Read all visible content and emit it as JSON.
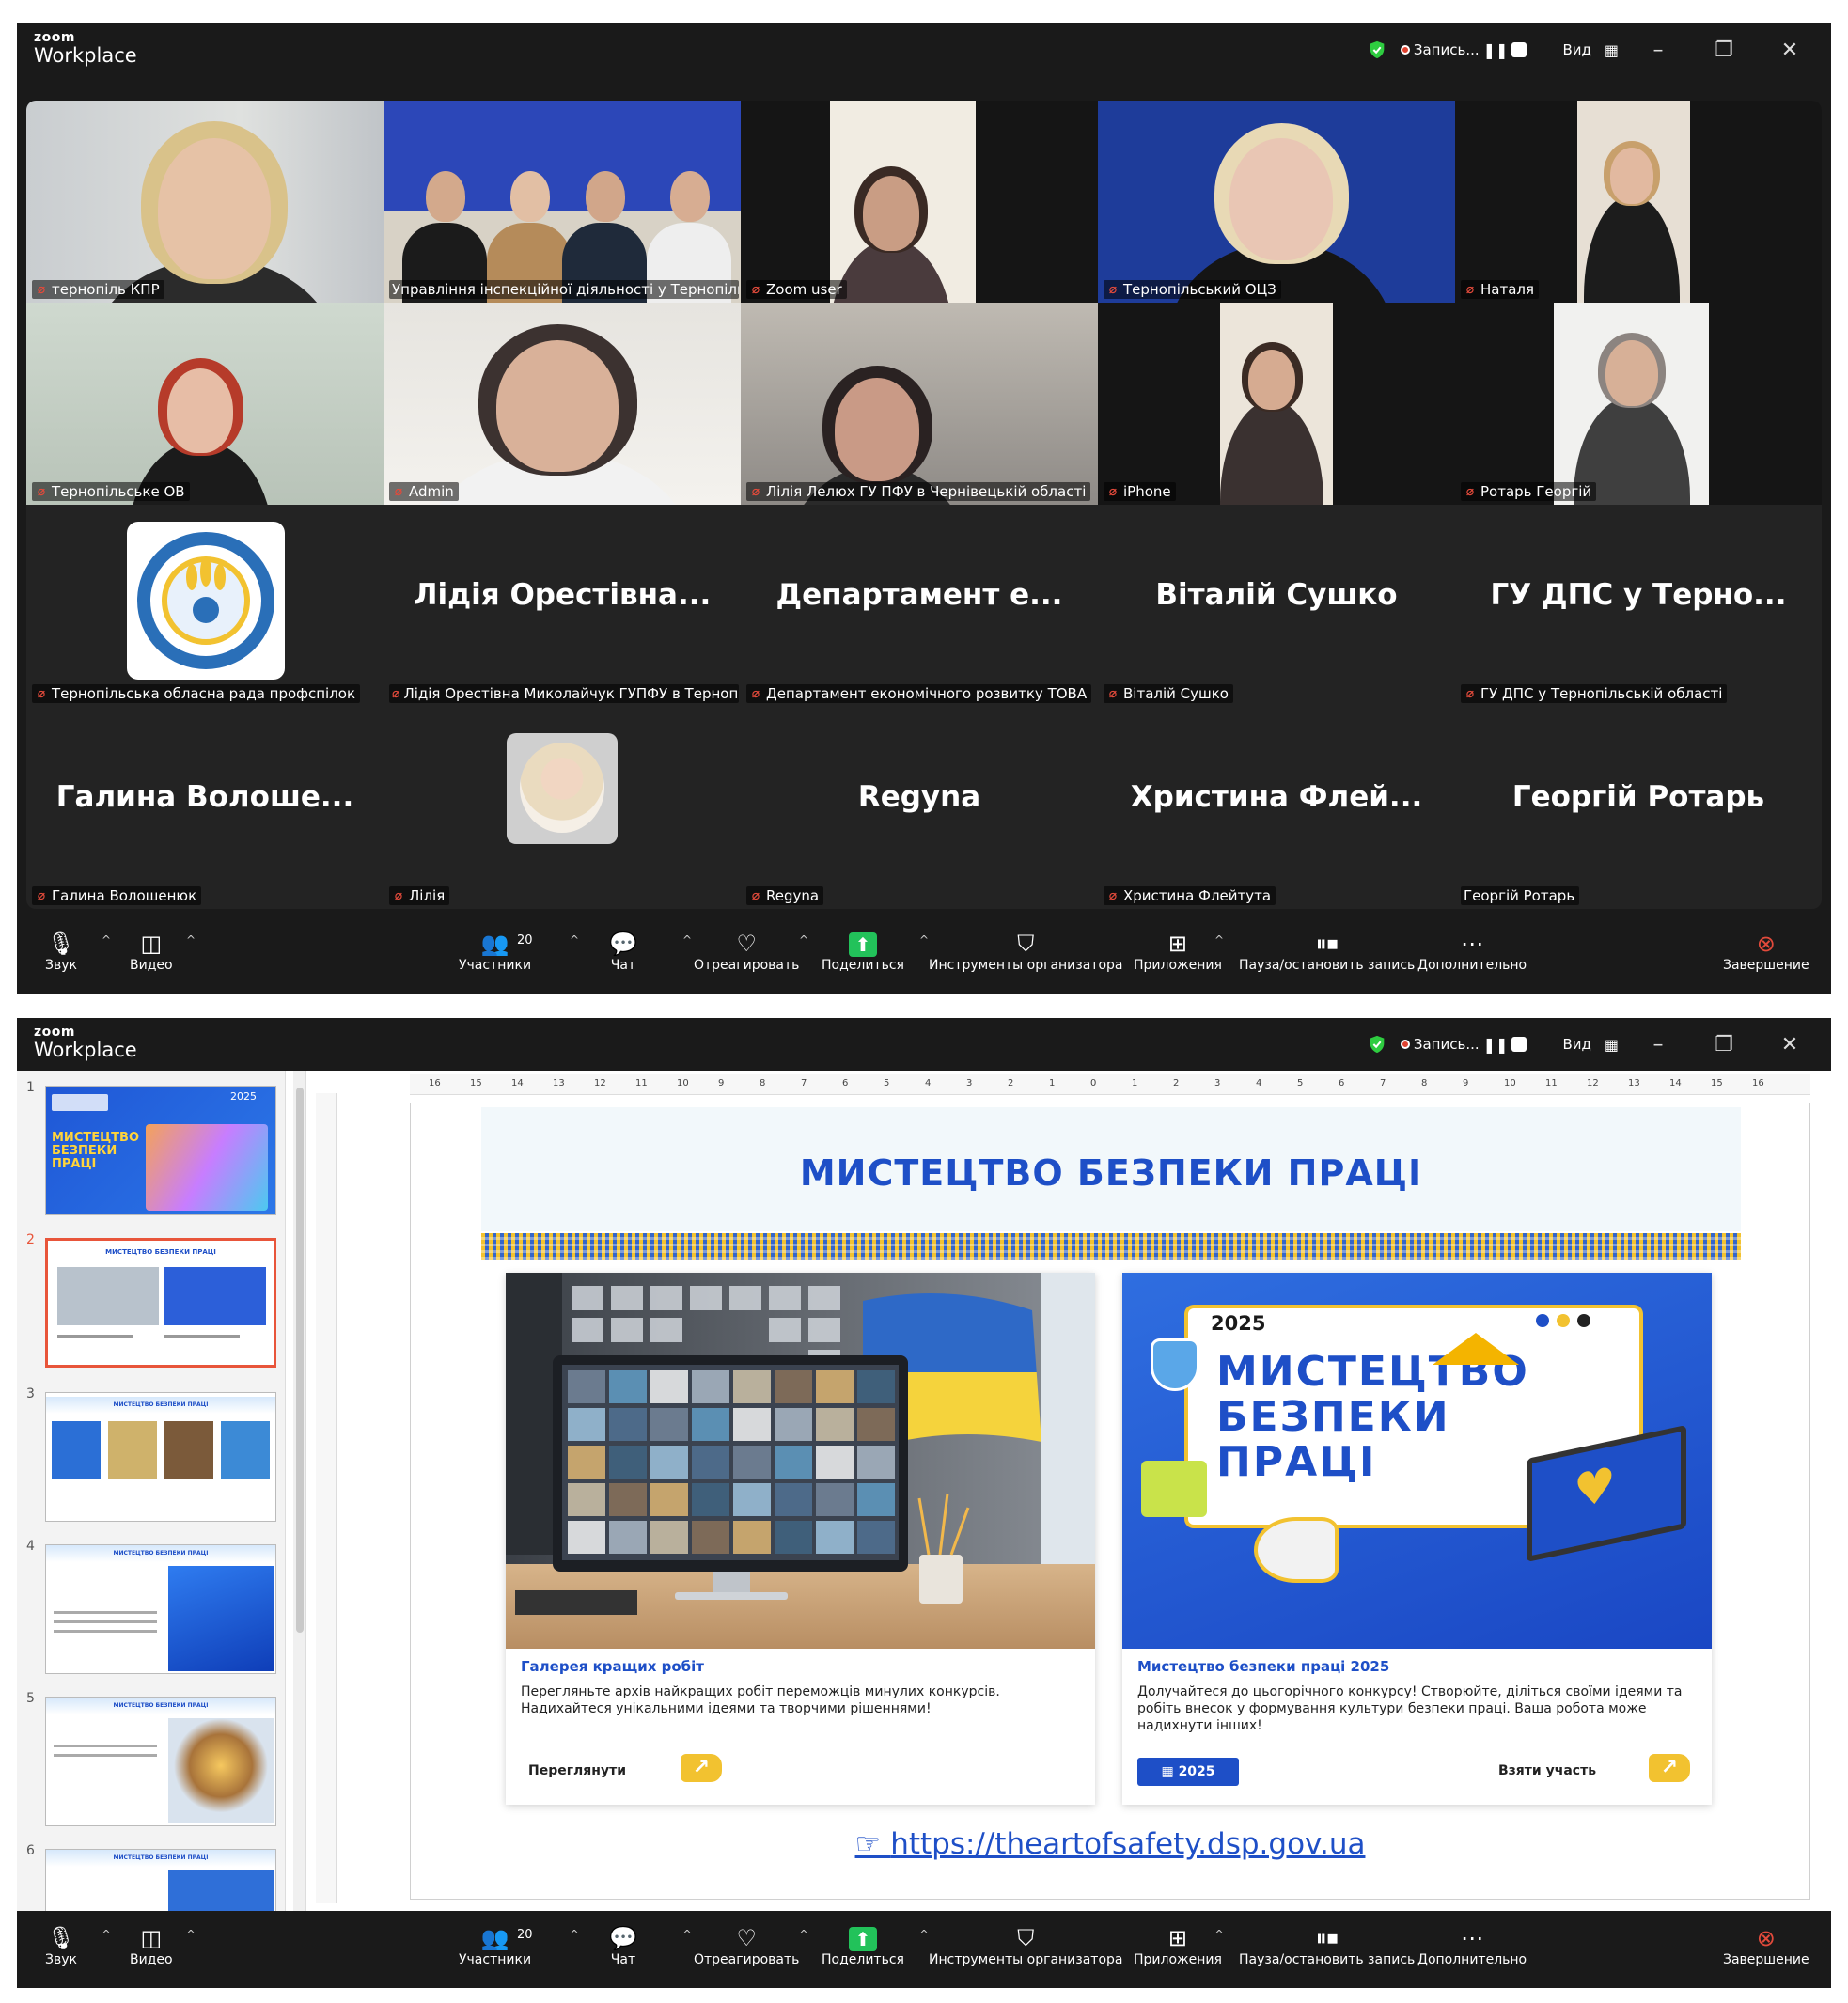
{
  "app": {
    "logo_top": "zoom",
    "logo_bottom": "Workplace"
  },
  "titlebar": {
    "recording_label": "Запись...",
    "view_label": "Вид"
  },
  "gallery": {
    "tiles": [
      {
        "name": "тернопіль КПР",
        "muted": true
      },
      {
        "name": "Управління інспекційної діяльності у Тернопільс...",
        "muted": false
      },
      {
        "name": "Zoom user",
        "muted": true
      },
      {
        "name": "Тернопільський ОЦЗ",
        "muted": true
      },
      {
        "name": "Наталя",
        "muted": true
      },
      {
        "name": "Тернопільське ОВ",
        "muted": true
      },
      {
        "name": "Admin",
        "muted": true
      },
      {
        "name": "Лілія Лелюх ГУ ПФУ в Чернівецькій області",
        "muted": true
      },
      {
        "name": "iPhone",
        "muted": true
      },
      {
        "name": "Ротарь Георгій",
        "muted": true
      },
      {
        "name": "Тернопільська обласна рада профспілок",
        "muted": true,
        "big": ""
      },
      {
        "name": "Лідія Орестівна Миколайчук ГУПФУ в Тернопіл...",
        "muted": true,
        "big": "Лідія Орестівна..."
      },
      {
        "name": "Департамент економічного розвитку ТОВА",
        "muted": true,
        "big": "Департамент е..."
      },
      {
        "name": "Віталій Сушко",
        "muted": true,
        "big": "Віталій Сушко"
      },
      {
        "name": "ГУ ДПС у Тернопільській області",
        "muted": true,
        "big": "ГУ ДПС у Терно..."
      },
      {
        "name": "Галина Волошенюк",
        "muted": true,
        "big": "Галина Волоше..."
      },
      {
        "name": "Лілія",
        "muted": true,
        "big": ""
      },
      {
        "name": "Regyna",
        "muted": true,
        "big": "Regyna"
      },
      {
        "name": "Христина Флейтута",
        "muted": true,
        "big": "Христина Флей..."
      },
      {
        "name": "Георгій Ротарь",
        "muted": false,
        "big": "Георгій Ротарь"
      }
    ],
    "logo_ring_text": "ТЕРНОПІЛЬСЬКА ОБЛАСНА РАДА ПРОФСПІЛОК"
  },
  "toolbar": {
    "audio": "Звук",
    "video": "Видео",
    "participants": "Участники",
    "participants_count": "20",
    "chat": "Чат",
    "react": "Отреагировать",
    "share": "Поделиться",
    "host_tools": "Инструменты организатора",
    "apps": "Приложения",
    "pause_record": "Пауза/остановить запись",
    "more": "Дополнительно",
    "end": "Завершение"
  },
  "thumbnails": {
    "numbers": [
      "1",
      "2",
      "3",
      "4",
      "5",
      "6"
    ],
    "selected": 2,
    "t1_title": "МИСТЕЦТВО БЕЗПЕКИ ПРАЦІ",
    "t1_year": "2025",
    "small_title": "МИСТЕЦТВО БЕЗПЕКИ ПРАЦІ"
  },
  "ruler": {
    "labels": [
      "16",
      "15",
      "14",
      "13",
      "12",
      "11",
      "10",
      "9",
      "8",
      "7",
      "6",
      "5",
      "4",
      "3",
      "2",
      "1",
      "0",
      "1",
      "2",
      "3",
      "4",
      "5",
      "6",
      "7",
      "8",
      "9",
      "10",
      "11",
      "12",
      "13",
      "14",
      "15",
      "16"
    ]
  },
  "slide": {
    "title": "МИСТЕЦТВО БЕЗПЕКИ ПРАЦІ",
    "card1": {
      "title": "Галерея кращих робіт",
      "text": "Перегляньте архів найкращих робіт переможців минулих конкурсів. Надихайтеся унікальними ідеями та творчими рішеннями!",
      "link": "Переглянути"
    },
    "card2": {
      "poster_year": "2025",
      "poster_title_1": "МИСТЕЦТВО",
      "poster_title_2": "БЕЗПЕКИ",
      "poster_title_3": "ПРАЦІ",
      "title": "Мистецтво безпеки праці 2025",
      "text": "Долучайтеся до цьогорічного конкурсу! Створюйте, діліться своїми ідеями та робіть внесок у формування культури безпеки праці. Ваша робота може надихнути інших!",
      "year_button": "2025",
      "link": "Взяти участь"
    },
    "url": "https://theartofsafety.dsp.gov.ua"
  },
  "colors": {
    "accent_blue": "#1e4fc7",
    "accent_yellow": "#f2c230",
    "active_speaker": "#2ed573",
    "mic_off": "#e24a3b"
  }
}
